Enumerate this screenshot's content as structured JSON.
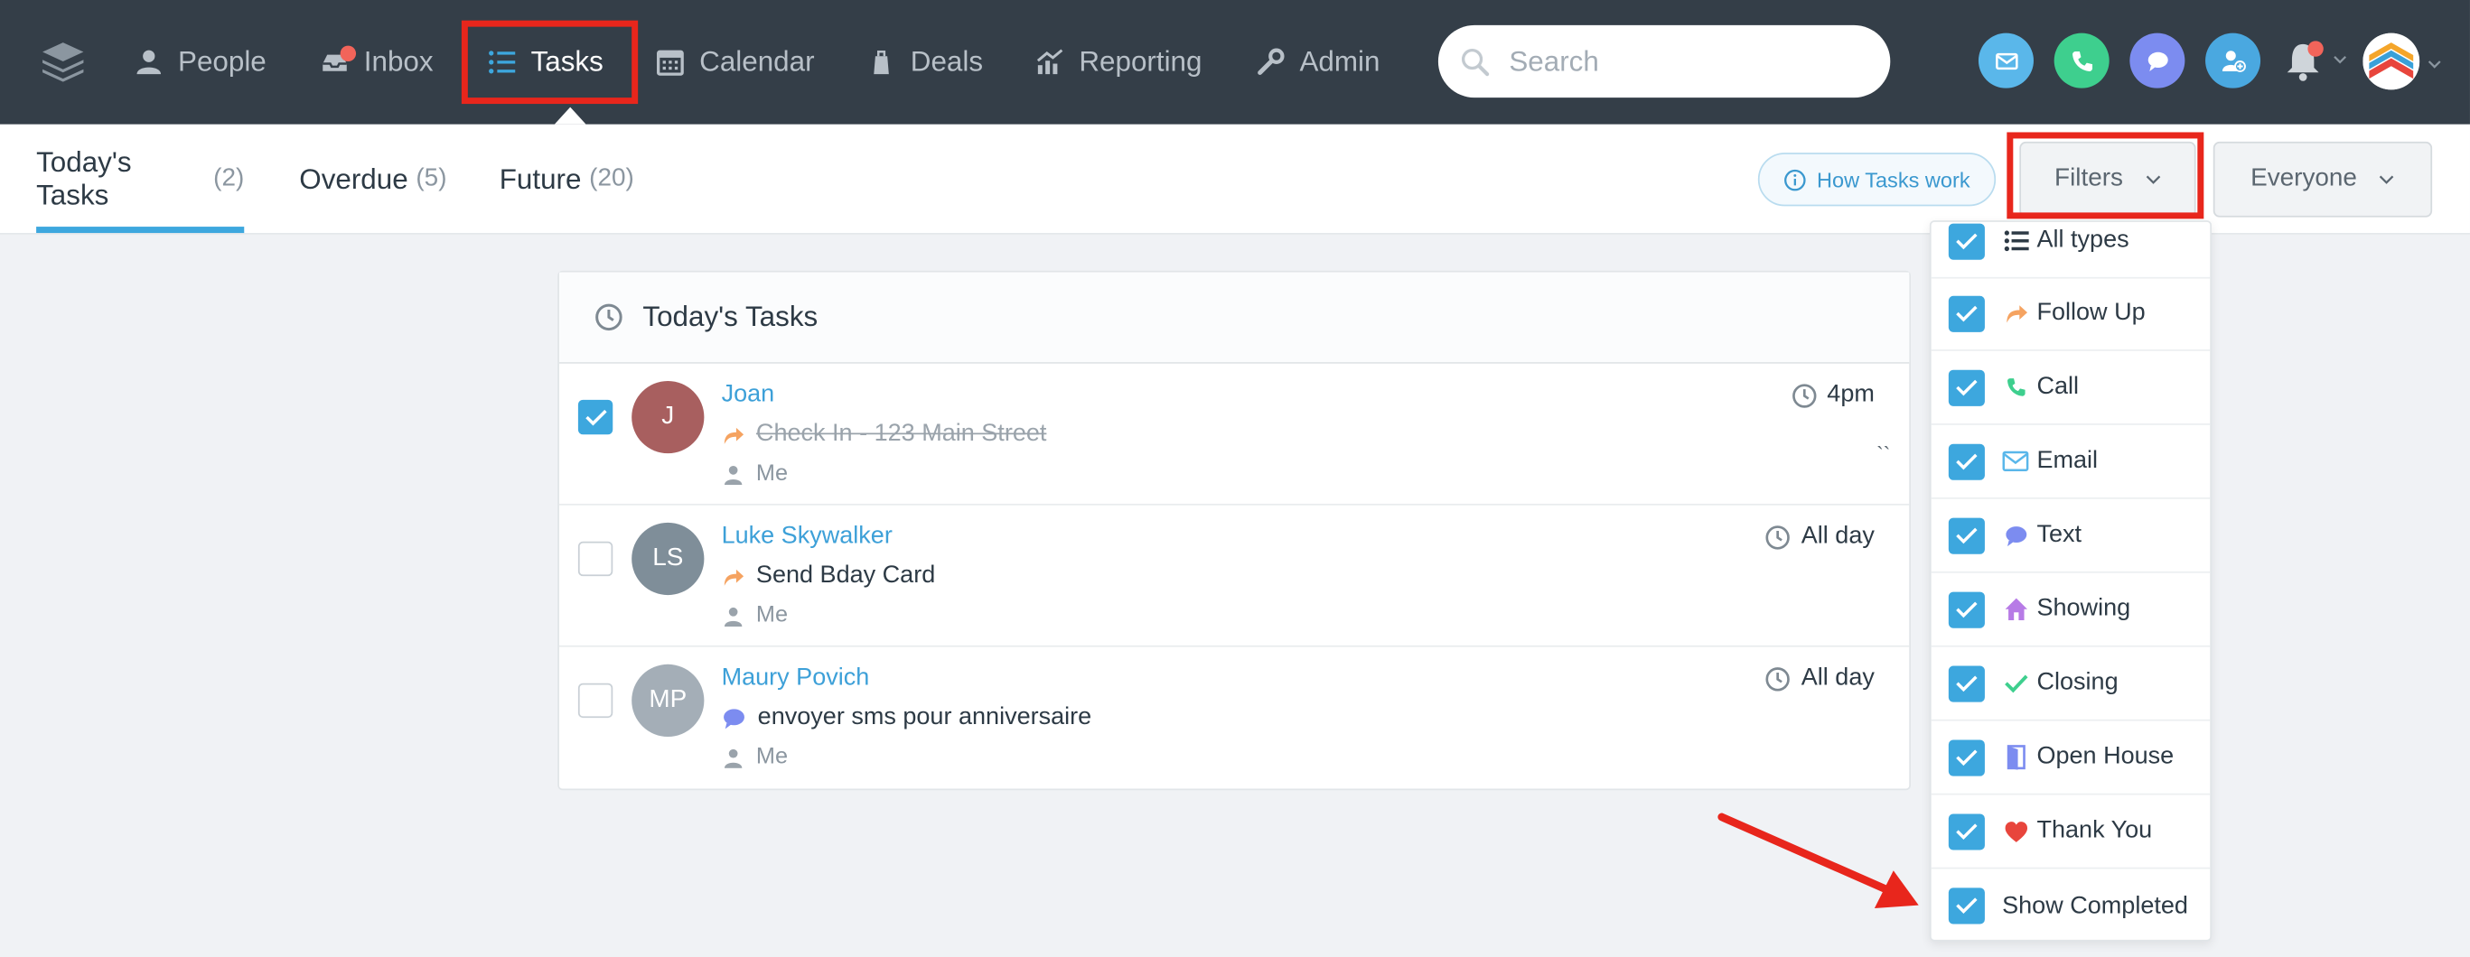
{
  "nav": {
    "items": [
      {
        "label": "People",
        "icon": "people-icon"
      },
      {
        "label": "Inbox",
        "icon": "inbox-icon"
      },
      {
        "label": "Tasks",
        "icon": "tasks-icon"
      },
      {
        "label": "Calendar",
        "icon": "calendar-icon"
      },
      {
        "label": "Deals",
        "icon": "deals-icon"
      },
      {
        "label": "Reporting",
        "icon": "reporting-icon"
      },
      {
        "label": "Admin",
        "icon": "admin-icon"
      }
    ],
    "active": "Tasks"
  },
  "search": {
    "placeholder": "Search"
  },
  "tabs": [
    {
      "label": "Today's Tasks",
      "count": "(2)"
    },
    {
      "label": "Overdue",
      "count": "(5)"
    },
    {
      "label": "Future",
      "count": "(20)"
    }
  ],
  "how_tasks_label": "How Tasks work",
  "filters_label": "Filters",
  "everyone_label": "Everyone",
  "card": {
    "title": "Today's Tasks"
  },
  "tasks": [
    {
      "initials": "J",
      "name": "Joan",
      "description": "Check In - 123 Main Street",
      "owner": "Me",
      "time": "4pm",
      "completed": true,
      "avatar_color": "#a85f5f",
      "mark": "``"
    },
    {
      "initials": "LS",
      "name": "Luke Skywalker",
      "description": "Send Bday Card",
      "owner": "Me",
      "time": "All day",
      "completed": false,
      "avatar_color": "#7f8e99"
    },
    {
      "initials": "MP",
      "name": "Maury Povich",
      "description": "envoyer sms pour anniversaire",
      "owner": "Me",
      "time": "All day",
      "completed": false,
      "avatar_color": "#a4aeb7"
    }
  ],
  "filters": [
    {
      "label": "All types",
      "icon": "list-icon",
      "checked": true
    },
    {
      "label": "Follow Up",
      "icon": "follow-up-icon",
      "checked": true
    },
    {
      "label": "Call",
      "icon": "phone-icon",
      "checked": true
    },
    {
      "label": "Email",
      "icon": "email-icon",
      "checked": true
    },
    {
      "label": "Text",
      "icon": "chat-icon",
      "checked": true
    },
    {
      "label": "Showing",
      "icon": "house-icon",
      "checked": true
    },
    {
      "label": "Closing",
      "icon": "checkmark-icon",
      "checked": true
    },
    {
      "label": "Open House",
      "icon": "door-icon",
      "checked": true
    },
    {
      "label": "Thank You",
      "icon": "heart-icon",
      "checked": true
    },
    {
      "label": "Show Completed",
      "icon": "",
      "checked": true
    }
  ],
  "colors": {
    "nav_bg": "#343e48",
    "accent": "#3da7de",
    "highlight": "#e8261c"
  }
}
